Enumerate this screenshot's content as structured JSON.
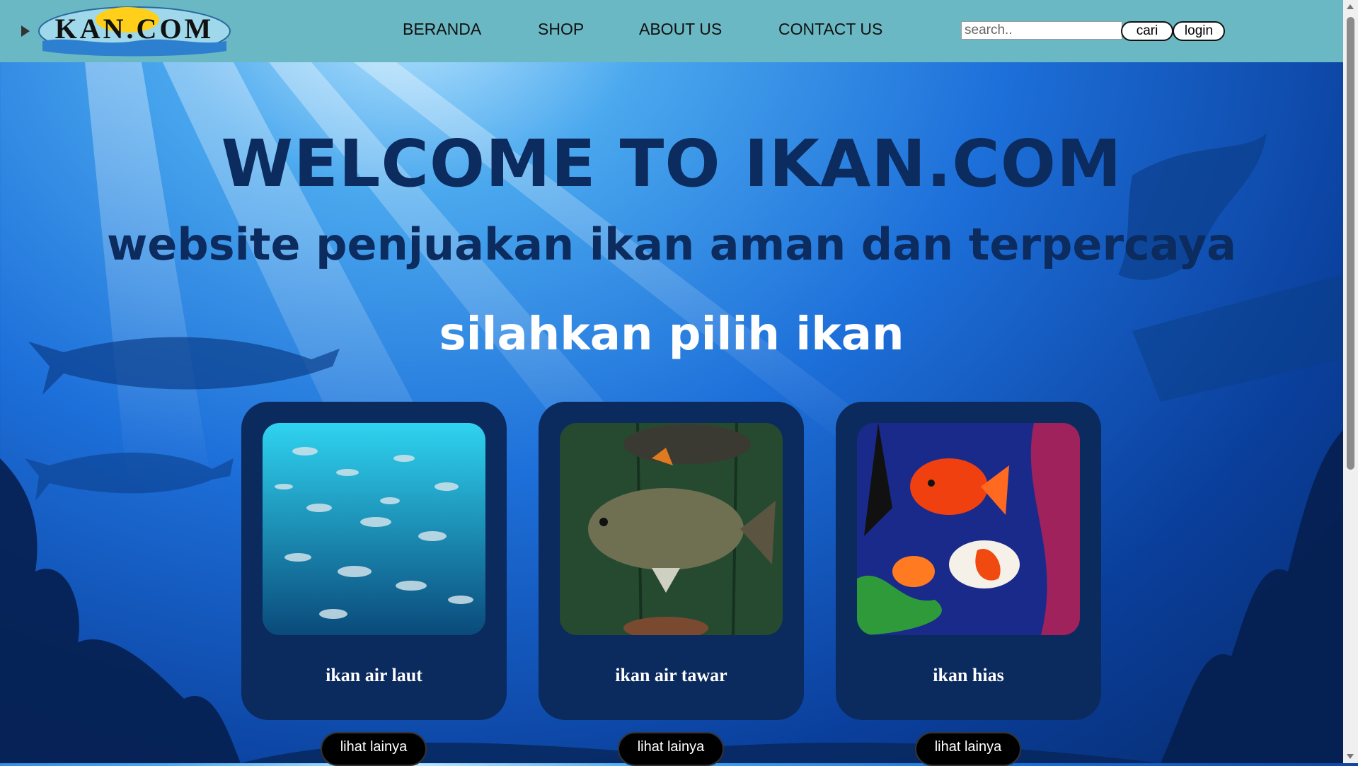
{
  "header": {
    "logo_text": "KAN.COM",
    "nav": [
      "BERANDA",
      "SHOP",
      "ABOUT US",
      "CONTACT US"
    ],
    "search_placeholder": "search..",
    "search_button": "cari",
    "login_button": "login"
  },
  "hero": {
    "title": "WELCOME TO IKAN.COM",
    "subtitle": "website penjuakan ikan aman dan terpercaya",
    "prompt": "silahkan pilih ikan"
  },
  "cards": [
    {
      "label": "ikan air laut",
      "button": "lihat lainya"
    },
    {
      "label": "ikan air tawar",
      "button": "lihat lainya"
    },
    {
      "label": "ikan hias",
      "button": "lihat lainya"
    }
  ],
  "colors": {
    "header_bg": "#6ab8c3",
    "card_bg": "#0b2a5e",
    "title_color": "#0c2b5e"
  }
}
